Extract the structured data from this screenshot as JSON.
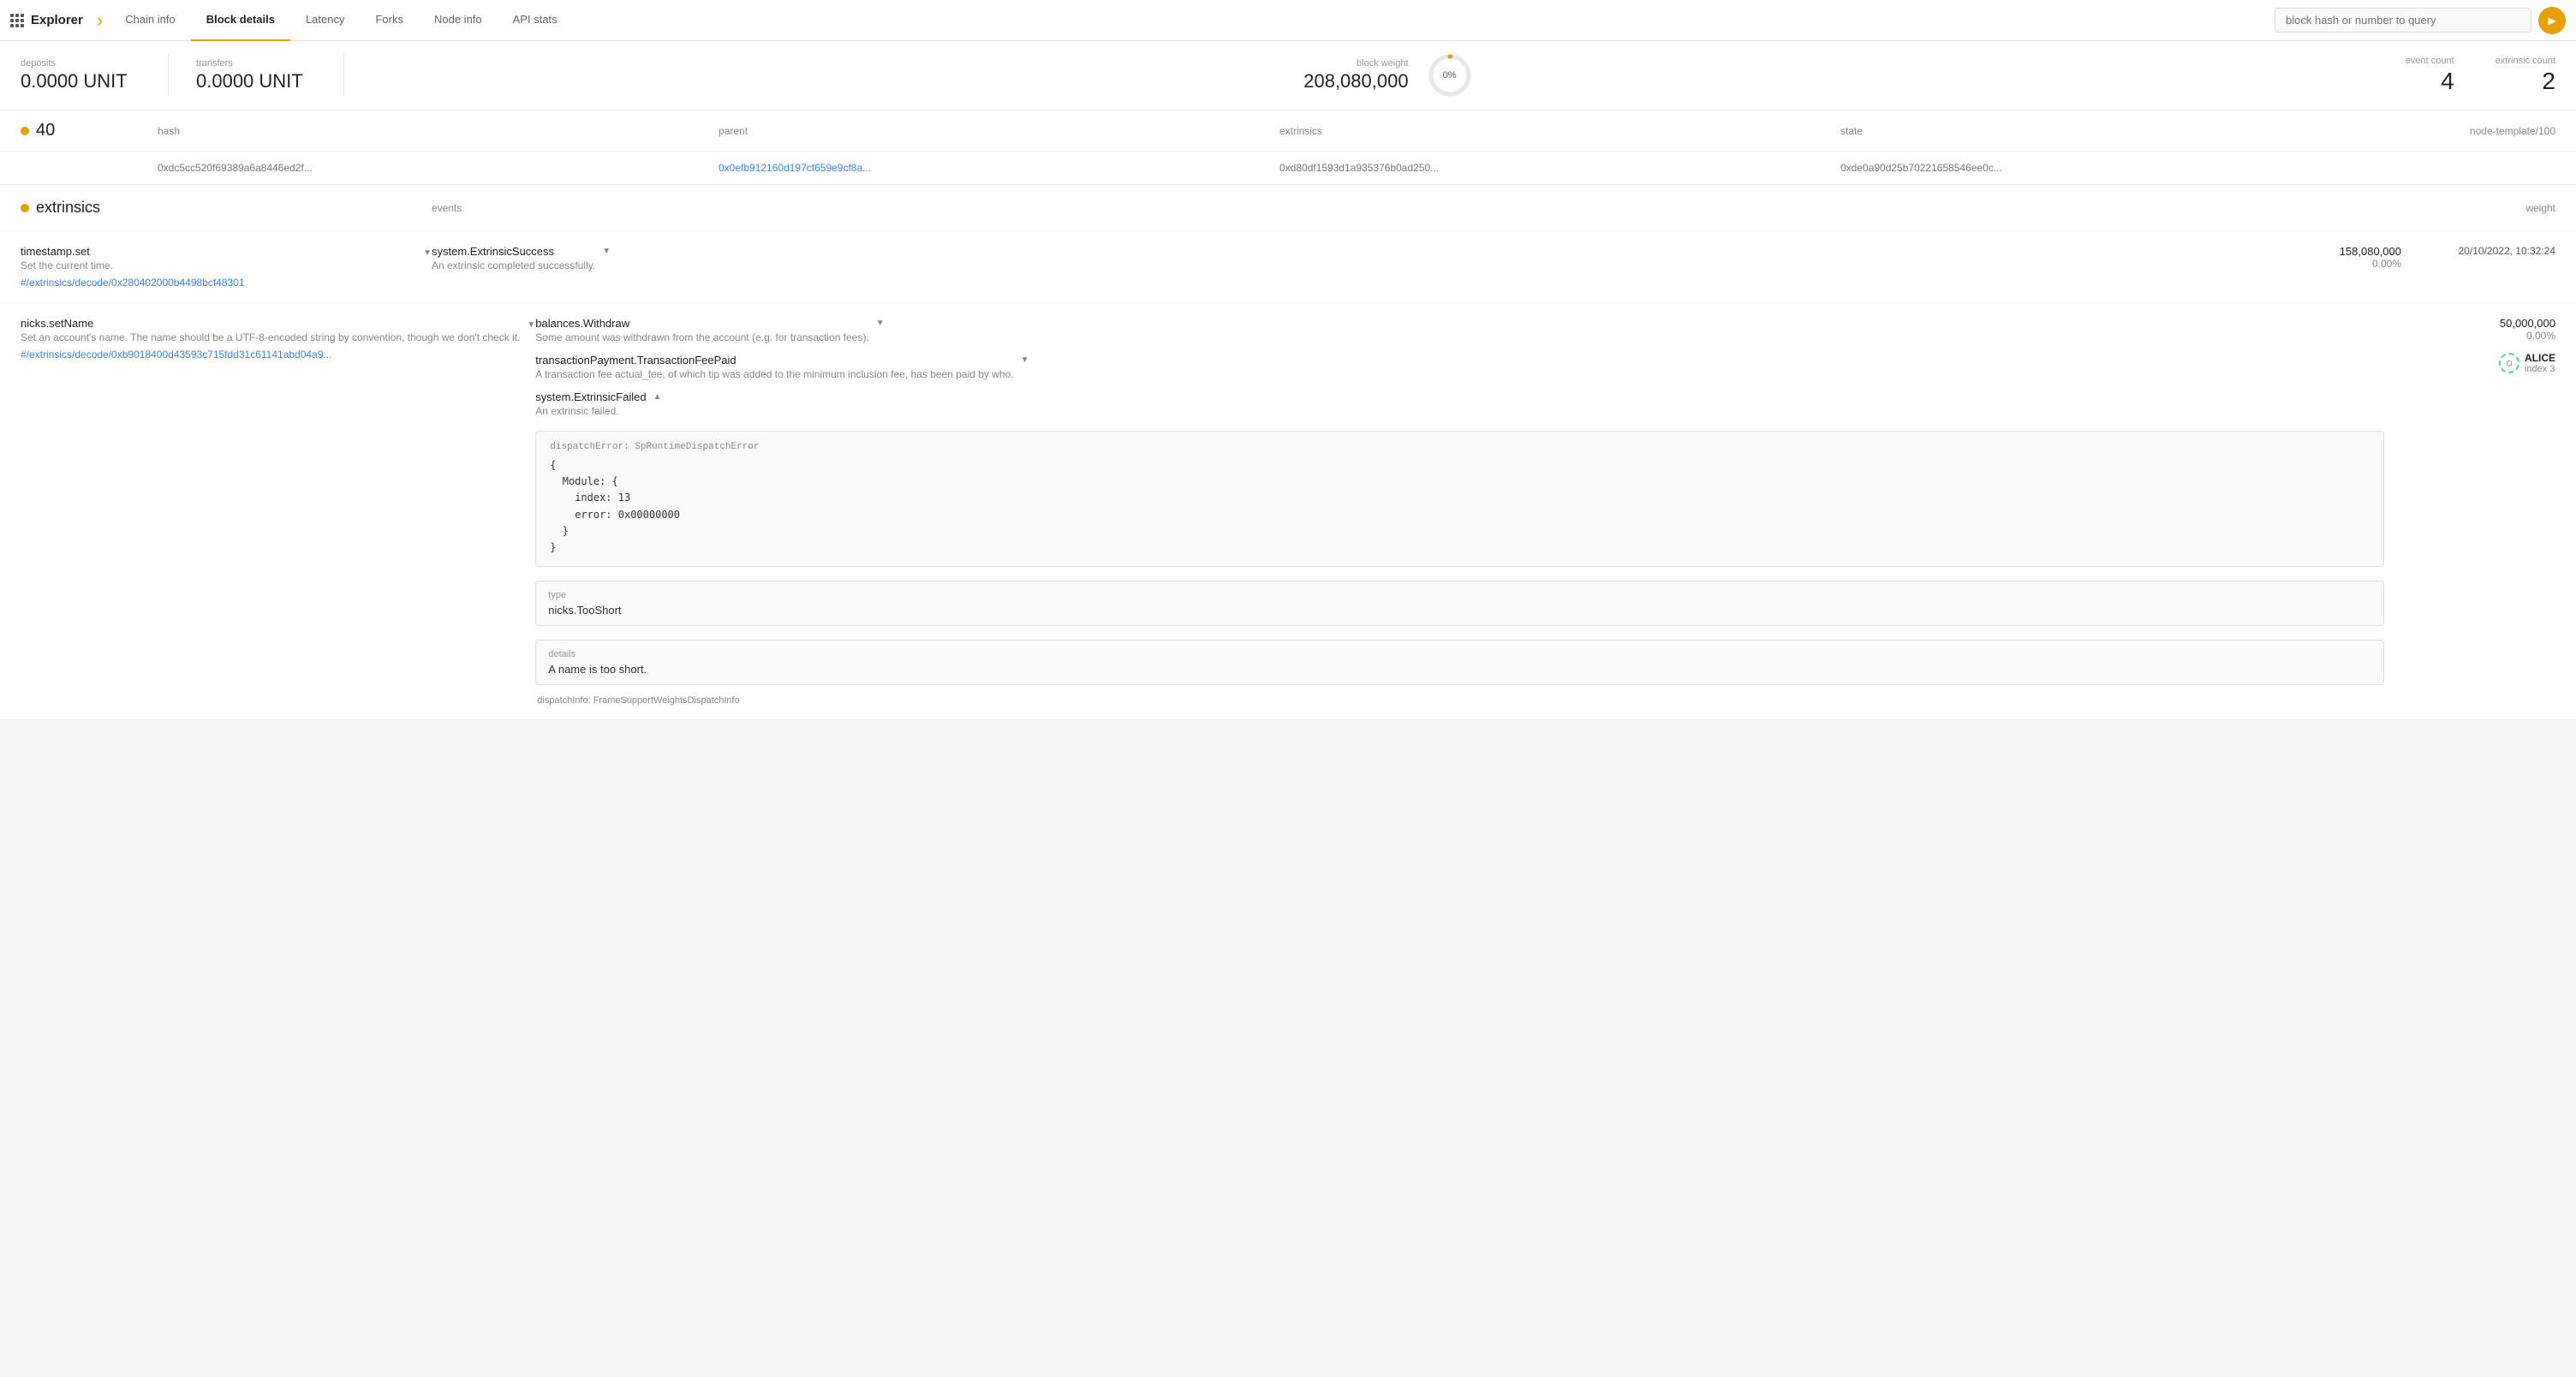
{
  "app": {
    "name": "Explorer",
    "grid_icon": true
  },
  "nav": {
    "tabs": [
      {
        "id": "chain-info",
        "label": "Chain info",
        "active": false
      },
      {
        "id": "block-details",
        "label": "Block details",
        "active": true
      },
      {
        "id": "latency",
        "label": "Latency",
        "active": false
      },
      {
        "id": "forks",
        "label": "Forks",
        "active": false
      },
      {
        "id": "node-info",
        "label": "Node info",
        "active": false
      },
      {
        "id": "api-stats",
        "label": "API stats",
        "active": false
      }
    ],
    "search_placeholder": "block hash or number to query"
  },
  "stats": {
    "deposits_label": "deposits",
    "deposits_value": "0.0000 UNIT",
    "transfers_label": "transfers",
    "transfers_value": "0.0000 UNIT",
    "block_weight_label": "block weight",
    "block_weight_value": "208,080,000",
    "block_weight_pct": "0%",
    "event_count_label": "event count",
    "event_count_value": "4",
    "extrinsic_count_label": "extrinsic count",
    "extrinsic_count_value": "2"
  },
  "block": {
    "number": "40",
    "col_hash": "hash",
    "col_parent": "parent",
    "col_extrinsics": "extrinsics",
    "col_state": "state",
    "col_runtime": "node-template/100",
    "hash_value": "0xdc5cc520f69389a6a8446ed2f...",
    "parent_value": "0x0efb912160d197cf659e9cf8a...",
    "extrinsics_value": "0xd80df1593d1a935376b0ad250...",
    "state_value": "0xde0a90d25b70221658546ee0c..."
  },
  "extrinsics": {
    "title": "extrinsics",
    "col_events": "events",
    "col_weight": "weight",
    "rows": [
      {
        "id": "timestamp-set",
        "name": "timestamp.set",
        "desc": "Set the current time.",
        "link": "#/extrinsics/decode/0x280402000b4498bcf48301",
        "events": [
          {
            "name": "system.ExtrinsicSuccess",
            "desc": "An extrinsic completed successfully.",
            "expanded": false
          }
        ],
        "weight_value": "158,080,000",
        "weight_pct": "0.00%",
        "timestamp": "20/10/2022, 10:32:24"
      },
      {
        "id": "nicks-setname",
        "name": "nicks.setName",
        "desc": "Set an account's name. The name should be a UTF-8-encoded string by convention, though we don't check it.",
        "link": "#/extrinsics/decode/0xb9018400d43593c715fdd31c61141abd04a9...",
        "events": [
          {
            "name": "balances.Withdraw",
            "desc": "Some amount was withdrawn from the account (e.g. for transaction fees).",
            "expanded": false
          },
          {
            "name": "transactionPayment.TransactionFeePaid",
            "desc": "A transaction fee actual_fee, of which tip was added to the minimum inclusion fee, has been paid by who.",
            "expanded": false
          },
          {
            "name": "system.ExtrinsicFailed",
            "desc": "An extrinsic failed.",
            "expanded": true,
            "dispatch_error_code": "dispatchError: SpRuntimeDispatchError",
            "dispatch_error_body": "{\n  Module: {\n    index: 13\n    error: 0x00000000\n  }\n}",
            "type_label": "type",
            "type_value": "nicks.TooShort",
            "details_label": "details",
            "details_value": "A name is too short.",
            "dispatch_info_label": "dispatchInfo: FrameSupportWeightsDispatchInfo"
          }
        ],
        "weight_value": "50,000,000",
        "weight_pct": "0.00%",
        "alice": {
          "name": "ALICE",
          "index": "index 3"
        }
      }
    ]
  }
}
